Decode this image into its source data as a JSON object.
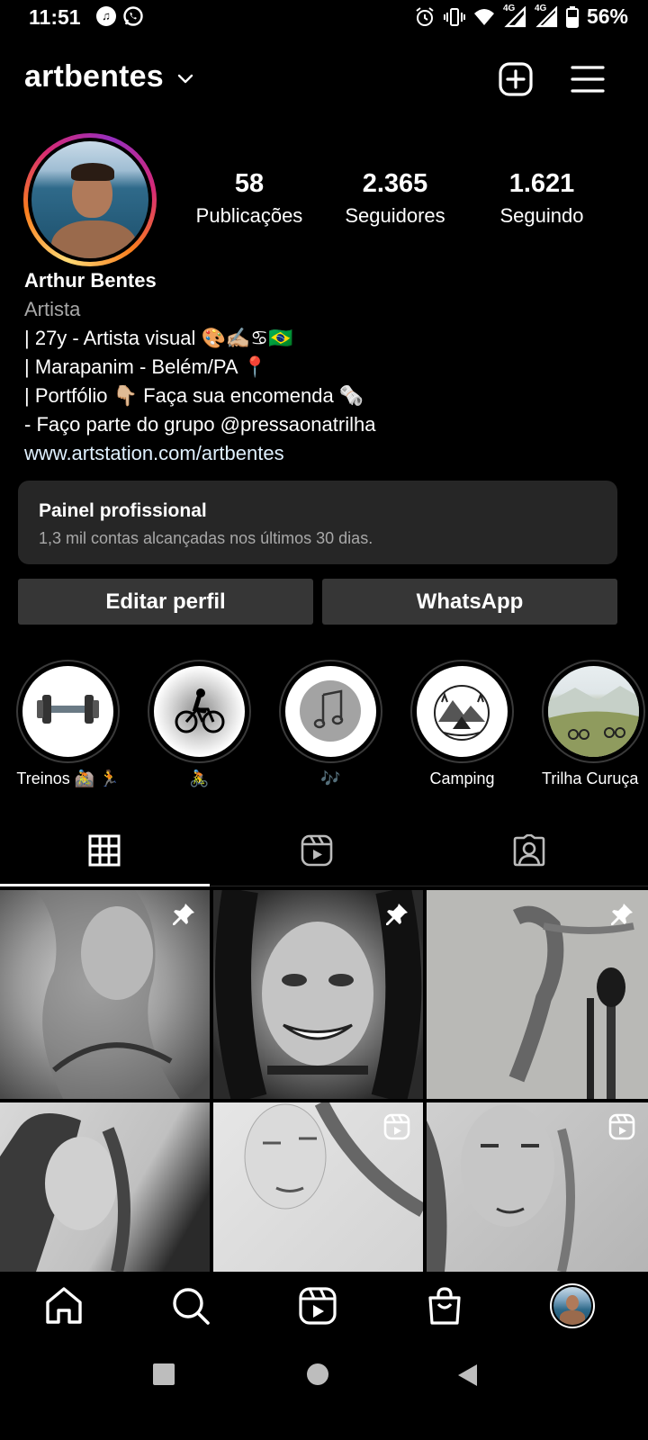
{
  "status_bar": {
    "time": "11:51",
    "battery": "56%",
    "icons": [
      "spotify-icon",
      "whatsapp-icon",
      "alarm-icon",
      "vibrate-icon",
      "wifi-icon",
      "signal-4g-icon",
      "signal-4g-icon",
      "battery-icon"
    ],
    "network_label": "4G"
  },
  "header": {
    "username": "artbentes",
    "icons": [
      "chevron-down-icon",
      "new-post-icon",
      "menu-icon"
    ]
  },
  "stats": [
    {
      "value": "58",
      "label": "Publicações"
    },
    {
      "value": "2.365",
      "label": "Seguidores"
    },
    {
      "value": "1.621",
      "label": "Seguindo"
    }
  ],
  "bio": {
    "name": "Arthur Bentes",
    "category": "Artista",
    "lines": [
      "| 27y - Artista visual 🎨✍🏼♋🇧🇷",
      "| Marapanim - Belém/PA 📍",
      "| Portfólio 👇🏼 Faça sua encomenda 🗞️",
      "- Faço parte do grupo @pressaonatrilha"
    ],
    "link": "www.artstation.com/artbentes"
  },
  "pro_panel": {
    "title": "Painel profissional",
    "subtitle": "1,3 mil contas alcançadas nos últimos 30 dias."
  },
  "actions": {
    "edit_profile": "Editar perfil",
    "whatsapp": "WhatsApp"
  },
  "highlights": [
    {
      "label": "Treinos 🚵 🏃"
    },
    {
      "label": "🚴"
    },
    {
      "label": "🎶"
    },
    {
      "label": "Camping"
    },
    {
      "label": "Trilha Curuça"
    }
  ],
  "tabs": [
    "grid-icon",
    "reels-icon",
    "tagged-icon"
  ],
  "posts": [
    {
      "kind": "pinned",
      "icon": "pin-icon"
    },
    {
      "kind": "pinned",
      "icon": "pin-icon"
    },
    {
      "kind": "pinned",
      "icon": "pin-icon"
    },
    {
      "kind": "photo",
      "icon": ""
    },
    {
      "kind": "reel",
      "icon": "reels-icon"
    },
    {
      "kind": "reel",
      "icon": "reels-icon"
    }
  ],
  "bottom_nav": [
    "home-icon",
    "search-icon",
    "reels-icon",
    "shop-icon",
    "profile-avatar"
  ],
  "colors": {
    "background": "#000000",
    "panel": "#262626",
    "button": "#363636",
    "muted_text": "#a8a8a8",
    "link_text": "#e0f1ff"
  }
}
